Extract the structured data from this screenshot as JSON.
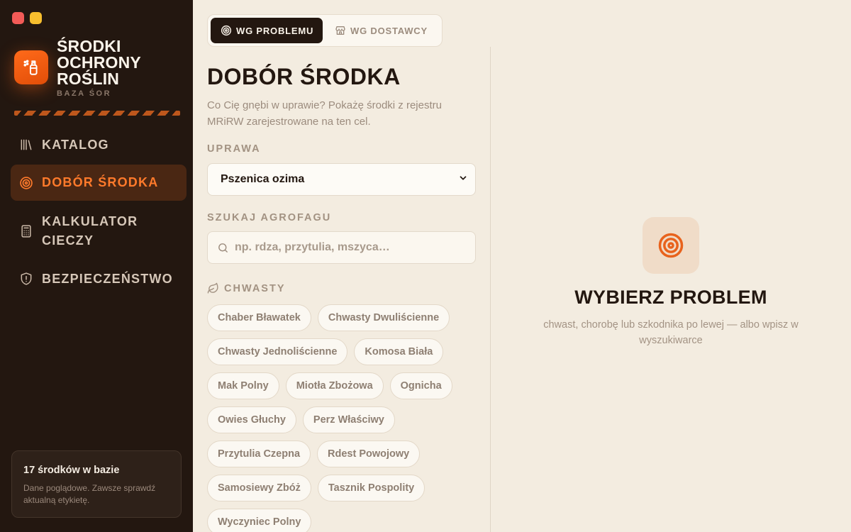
{
  "app": {
    "title": "ŚRODKI OCHRONY ROŚLIN",
    "subtitle": "BAZA ŚOR"
  },
  "nav": {
    "items": [
      {
        "label": "KATALOG",
        "icon": "library-icon"
      },
      {
        "label": "DOBÓR ŚRODKA",
        "icon": "target-icon",
        "active": true
      },
      {
        "label": "KALKULATOR CIECZY",
        "icon": "calculator-icon"
      },
      {
        "label": "BEZPIECZEŃSTWO",
        "icon": "shield-alert-icon"
      }
    ]
  },
  "info_card": {
    "title": "17 środków w bazie",
    "text": "Dane poglądowe. Zawsze sprawdź aktualną etykietę."
  },
  "mode_tabs": [
    {
      "label": "WG PROBLEMU",
      "icon": "target-icon",
      "active": true
    },
    {
      "label": "WG DOSTAWCY",
      "icon": "store-icon",
      "active": false
    }
  ],
  "main": {
    "title": "DOBÓR ŚRODKA",
    "description": "Co Cię gnębi w uprawie? Pokażę środki z rejestru MRiRW zarejestrowane na ten cel.",
    "crop_label": "UPRAWA",
    "crop_value": "Pszenica ozima",
    "search_label": "SZUKAJ AGROFAGU",
    "search_placeholder": "np. rdza, przytulia, mszyca…",
    "category": {
      "label": "CHWASTY",
      "icon": "leaf-icon"
    },
    "chip_rows": [
      [
        "Chaber Bławatek",
        "Chwasty Dwuliścienne"
      ],
      [
        "Chwasty Jednoliścienne",
        "Komosa Biała"
      ],
      [
        "Mak Polny",
        "Miotła Zbożowa",
        "Ognicha"
      ],
      [
        "Owies Głuchy",
        "Perz Właściwy"
      ],
      [
        "Przytulia Czepna",
        "Rdest Powojowy"
      ],
      [
        "Samosiewy Zbóż",
        "Tasznik Pospolity"
      ],
      [
        "Wyczyniec Polny"
      ]
    ]
  },
  "empty_state": {
    "icon": "target-icon",
    "title": "WYBIERZ PROBLEM",
    "text": "chwast, chorobę lub szkodnika po lewej — albo wpisz w wyszukiwarce"
  },
  "colors": {
    "sidebar_bg": "#231710",
    "accent": "#ff7a2b",
    "page_bg": "#f3ece0"
  }
}
